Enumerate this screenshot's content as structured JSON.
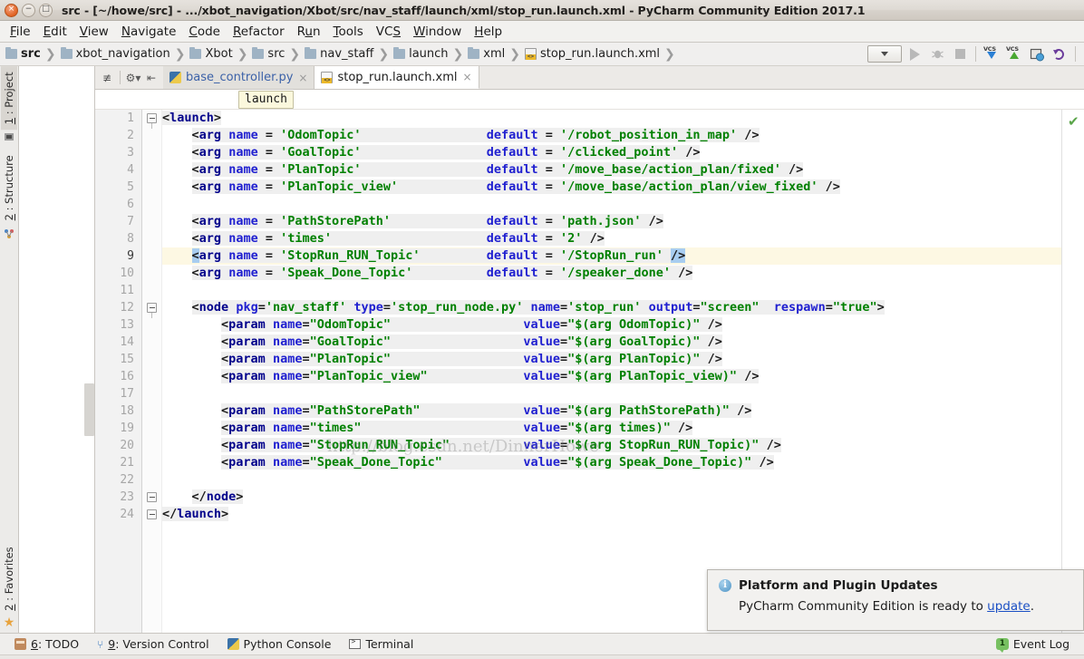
{
  "window": {
    "title": "src - [~/howe/src] - .../xbot_navigation/Xbot/src/nav_staff/launch/xml/stop_run.launch.xml - PyCharm Community Edition 2017.1",
    "close_glyph": "×",
    "minimize_glyph": "−",
    "maximize_glyph": "□"
  },
  "menubar": {
    "items": [
      {
        "label": "File",
        "mnemonic": "F"
      },
      {
        "label": "Edit",
        "mnemonic": "E"
      },
      {
        "label": "View",
        "mnemonic": "V"
      },
      {
        "label": "Navigate",
        "mnemonic": "N"
      },
      {
        "label": "Code",
        "mnemonic": "C"
      },
      {
        "label": "Refactor",
        "mnemonic": "R"
      },
      {
        "label": "Run",
        "mnemonic": "u"
      },
      {
        "label": "Tools",
        "mnemonic": "T"
      },
      {
        "label": "VCS",
        "mnemonic": "S"
      },
      {
        "label": "Window",
        "mnemonic": "W"
      },
      {
        "label": "Help",
        "mnemonic": "H"
      }
    ]
  },
  "breadcrumb": {
    "separator": "❯",
    "items": [
      {
        "label": "src",
        "icon": "folder-icon",
        "bold": true
      },
      {
        "label": "xbot_navigation",
        "icon": "folder-icon",
        "bold": false
      },
      {
        "label": "Xbot",
        "icon": "folder-icon",
        "bold": false
      },
      {
        "label": "src",
        "icon": "folder-icon",
        "bold": false
      },
      {
        "label": "nav_staff",
        "icon": "folder-icon",
        "bold": false
      },
      {
        "label": "launch",
        "icon": "folder-icon",
        "bold": false
      },
      {
        "label": "xml",
        "icon": "folder-icon",
        "bold": false
      },
      {
        "label": "stop_run.launch.xml",
        "icon": "xml-file-icon",
        "bold": false
      }
    ]
  },
  "nav_toolbar": {
    "run_config_label": "",
    "buttons": [
      "run-button",
      "debug-button",
      "stop-button",
      "vcs-update-button",
      "vcs-commit-button",
      "vcs-browser-button",
      "vcs-rollback-button"
    ],
    "vcs_label": "VCS"
  },
  "left_strip": {
    "tabs": [
      {
        "label": "1: Project",
        "mnemonic": "1",
        "selected": true,
        "icon": "project-icon"
      },
      {
        "label": "2: Structure",
        "mnemonic": "2",
        "selected": false,
        "icon": "structure-icon"
      }
    ],
    "bottom_tabs": [
      {
        "label": "2: Favorites",
        "mnemonic": "2",
        "selected": false,
        "icon": "star-icon"
      }
    ]
  },
  "editor_tabs": {
    "tools": [
      "collapse-all-icon",
      "settings-icon",
      "hide-icon"
    ],
    "tabs": [
      {
        "label": "base_controller.py",
        "icon": "python-file-icon",
        "active": false,
        "close": "×"
      },
      {
        "label": "stop_run.launch.xml",
        "icon": "xml-file-icon",
        "active": true,
        "close": "×"
      }
    ]
  },
  "editor": {
    "breadcrumb_chip": "launch",
    "inspection_status": "✔",
    "watermark": "http://blog.csdn.net/DinnerHowe",
    "current_line": 9,
    "line_numbers": [
      1,
      2,
      3,
      4,
      5,
      6,
      7,
      8,
      9,
      10,
      11,
      12,
      13,
      14,
      15,
      16,
      17,
      18,
      19,
      20,
      21,
      22,
      23,
      24
    ],
    "lines": [
      {
        "n": 1,
        "indent": 0,
        "fold": "open",
        "text": "<launch>"
      },
      {
        "n": 2,
        "indent": 4,
        "text": "<arg name = 'OdomTopic'                 default = '/robot_position_in_map' />"
      },
      {
        "n": 3,
        "indent": 4,
        "text": "<arg name = 'GoalTopic'                 default = '/clicked_point' />"
      },
      {
        "n": 4,
        "indent": 4,
        "text": "<arg name = 'PlanTopic'                 default = '/move_base/action_plan/fixed' />"
      },
      {
        "n": 5,
        "indent": 4,
        "text": "<arg name = 'PlanTopic_view'            default = '/move_base/action_plan/view_fixed' />"
      },
      {
        "n": 6,
        "indent": 0,
        "text": ""
      },
      {
        "n": 7,
        "indent": 4,
        "text": "<arg name = 'PathStorePath'             default = 'path.json' />"
      },
      {
        "n": 8,
        "indent": 4,
        "text": "<arg name = 'times'                     default = '2' />"
      },
      {
        "n": 9,
        "indent": 4,
        "text": "<arg name = 'StopRun_RUN_Topic'         default = '/StopRun_run' />"
      },
      {
        "n": 10,
        "indent": 4,
        "text": "<arg name = 'Speak_Done_Topic'          default = '/speaker_done' />"
      },
      {
        "n": 11,
        "indent": 0,
        "text": ""
      },
      {
        "n": 12,
        "indent": 4,
        "fold": "open",
        "text": "<node pkg='nav_staff' type='stop_run_node.py' name='stop_run' output=\"screen\"  respawn=\"true\">"
      },
      {
        "n": 13,
        "indent": 8,
        "text": "<param name=\"OdomTopic\"                  value=\"$(arg OdomTopic)\" />"
      },
      {
        "n": 14,
        "indent": 8,
        "text": "<param name=\"GoalTopic\"                  value=\"$(arg GoalTopic)\" />"
      },
      {
        "n": 15,
        "indent": 8,
        "text": "<param name=\"PlanTopic\"                  value=\"$(arg PlanTopic)\" />"
      },
      {
        "n": 16,
        "indent": 8,
        "text": "<param name=\"PlanTopic_view\"             value=\"$(arg PlanTopic_view)\" />"
      },
      {
        "n": 17,
        "indent": 0,
        "text": ""
      },
      {
        "n": 18,
        "indent": 8,
        "text": "<param name=\"PathStorePath\"              value=\"$(arg PathStorePath)\" />"
      },
      {
        "n": 19,
        "indent": 8,
        "text": "<param name=\"times\"                      value=\"$(arg times)\" />"
      },
      {
        "n": 20,
        "indent": 8,
        "text": "<param name=\"StopRun_RUN_Topic\"          value=\"$(arg StopRun_RUN_Topic)\" />"
      },
      {
        "n": 21,
        "indent": 8,
        "text": "<param name=\"Speak_Done_Topic\"           value=\"$(arg Speak_Done_Topic)\" />"
      },
      {
        "n": 22,
        "indent": 0,
        "text": ""
      },
      {
        "n": 23,
        "indent": 4,
        "fold": "close",
        "text": "</node>"
      },
      {
        "n": 24,
        "indent": 0,
        "fold": "close",
        "text": "</launch>"
      }
    ]
  },
  "notification": {
    "icon": "info-icon",
    "title": "Platform and Plugin Updates",
    "body_prefix": "PyCharm Community Edition is ready to ",
    "link": "update",
    "body_suffix": "."
  },
  "statusbar": {
    "items": [
      {
        "label": "6: TODO",
        "mnemonic": "6",
        "icon": "todo-icon"
      },
      {
        "label": "9: Version Control",
        "mnemonic": "9",
        "icon": "vcs-branch-icon"
      },
      {
        "label": "Python Console",
        "mnemonic": "",
        "icon": "python-icon"
      },
      {
        "label": "Terminal",
        "mnemonic": "",
        "icon": "terminal-icon"
      }
    ],
    "event_log": {
      "label": "Event Log",
      "count": "1"
    }
  },
  "colors": {
    "tag_name": "#00008b",
    "attribute": "#2020d0",
    "value": "#008000",
    "current_line": "#fdf8e3",
    "tag_bg": "#efefef",
    "match_highlight": "#a8cdf0",
    "link": "#1a4fc4"
  }
}
